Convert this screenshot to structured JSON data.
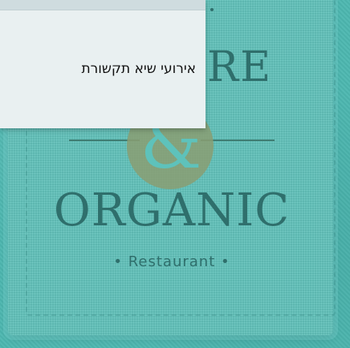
{
  "background": {
    "logo_top_text": "RE",
    "logo_ampersand": "&",
    "logo_name": "ORGANIC",
    "logo_subtitle": "• Restaurant •",
    "colors": {
      "background": "#4db7b0",
      "logo_text": "#2f6f6c",
      "ampersand_circle": "#8a9e72"
    }
  },
  "card": {
    "text": "אירועי שיא תקשורת"
  }
}
